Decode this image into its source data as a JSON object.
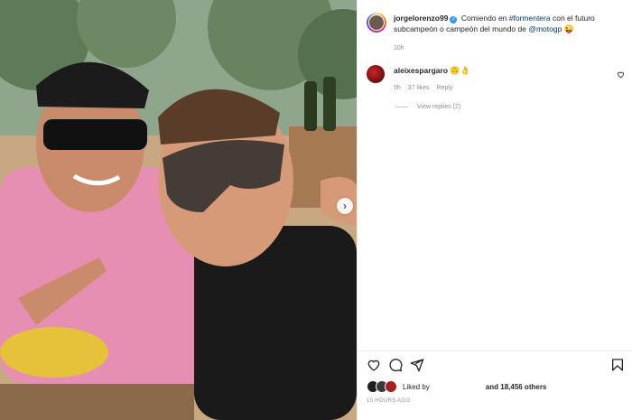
{
  "post": {
    "author": "jorgelorenzo99",
    "caption_prefix": "Comiendo en ",
    "hashtag": "#formentera",
    "caption_middle": " con el futuro subcampeón o campeón del mundo de ",
    "mention": "@motogp",
    "caption_emoji": "😜",
    "time": "10h"
  },
  "comment": {
    "author": "aleixespargaro",
    "text": "🙃👌",
    "time": "5h",
    "likes": "37 likes",
    "reply": "Reply",
    "view_replies": "View replies (2)"
  },
  "likes": {
    "liked_by": "Liked by",
    "and_others": "and 18,456 others"
  },
  "timestamp": "10 HOURS AGO",
  "icons": [
    "heart-icon",
    "comment-icon",
    "share-icon",
    "bookmark-icon",
    "chevron-right-icon",
    "verified-icon"
  ],
  "colors": {
    "link": "#00376b",
    "verified": "#3897f0",
    "muted": "#8e8e8e",
    "text": "#262626"
  }
}
